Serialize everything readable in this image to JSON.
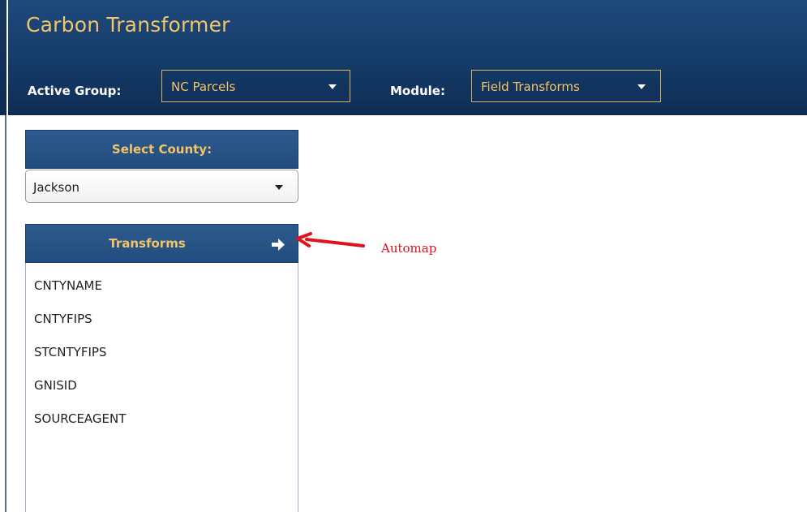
{
  "app": {
    "title": "Carbon Transformer"
  },
  "toolbar": {
    "active_group_label": "Active Group:",
    "active_group_value": "NC Parcels",
    "module_label": "Module:",
    "module_value": "Field Transforms"
  },
  "county_panel": {
    "header": "Select County:",
    "selected": "Jackson"
  },
  "transforms_panel": {
    "header": "Transforms",
    "items": [
      {
        "label": "CNTYNAME"
      },
      {
        "label": "CNTYFIPS"
      },
      {
        "label": "STCNTYFIPS"
      },
      {
        "label": "GNISID"
      },
      {
        "label": "SOURCEAGENT"
      }
    ]
  },
  "annotation": {
    "label": "Automap",
    "color": "#e0121b"
  },
  "colors": {
    "header_bg": "#163e6c",
    "accent_gold": "#f3c468",
    "panel_header_bg": "#2d5b8f"
  },
  "icons": {
    "automap": "arrow-right-icon",
    "dropdown": "caret-down-icon"
  }
}
